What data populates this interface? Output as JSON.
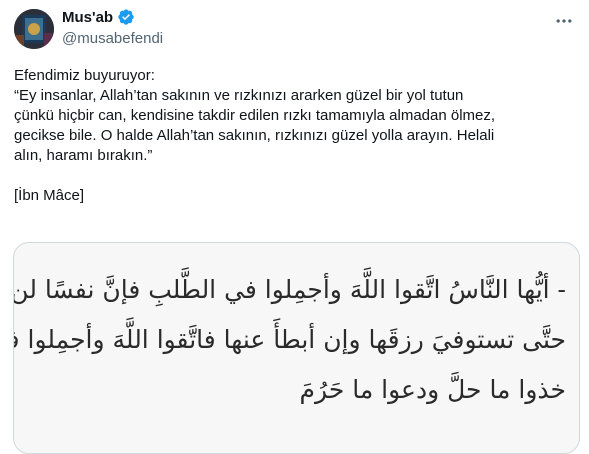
{
  "author": {
    "display_name": "Mus'ab",
    "handle": "@musabefendi",
    "avatar_icon": "avatar-image",
    "verified_color": "#1d9bf0"
  },
  "tweet": {
    "line1": "Efendimiz buyuruyor:",
    "line2": "“Ey insanlar, Allah’tan sakının ve rızkınızı ararken güzel bir yol tutun",
    "line3": "çünkü hiçbir can, kendisine takdir edilen rızkı tamamıyla almadan ölmez,",
    "line4": "gecikse bile. O halde Allah’tan sakının, rızkınızı güzel yolla arayın. Helali",
    "line5": "alın, haramı bırakın.”",
    "source": "[İbn Mâce]"
  },
  "media": {
    "arabic_line1": "- أيُّها النَّاسُ اتَّقوا اللَّهَ وأجمِلوا في الطَّلبِ فإنَّ نفسًا لن تموتَ",
    "arabic_line2": "حتَّى تستوفيَ رزقَها وإن أبطأَ عنها فاتَّقوا اللَّهَ وأجمِلوا في الطَّلبِ",
    "arabic_line3": "خذوا ما حلَّ ودعوا ما حَرُمَ"
  },
  "icons": {
    "more": "more-options-icon",
    "verified": "verified-badge-icon"
  }
}
